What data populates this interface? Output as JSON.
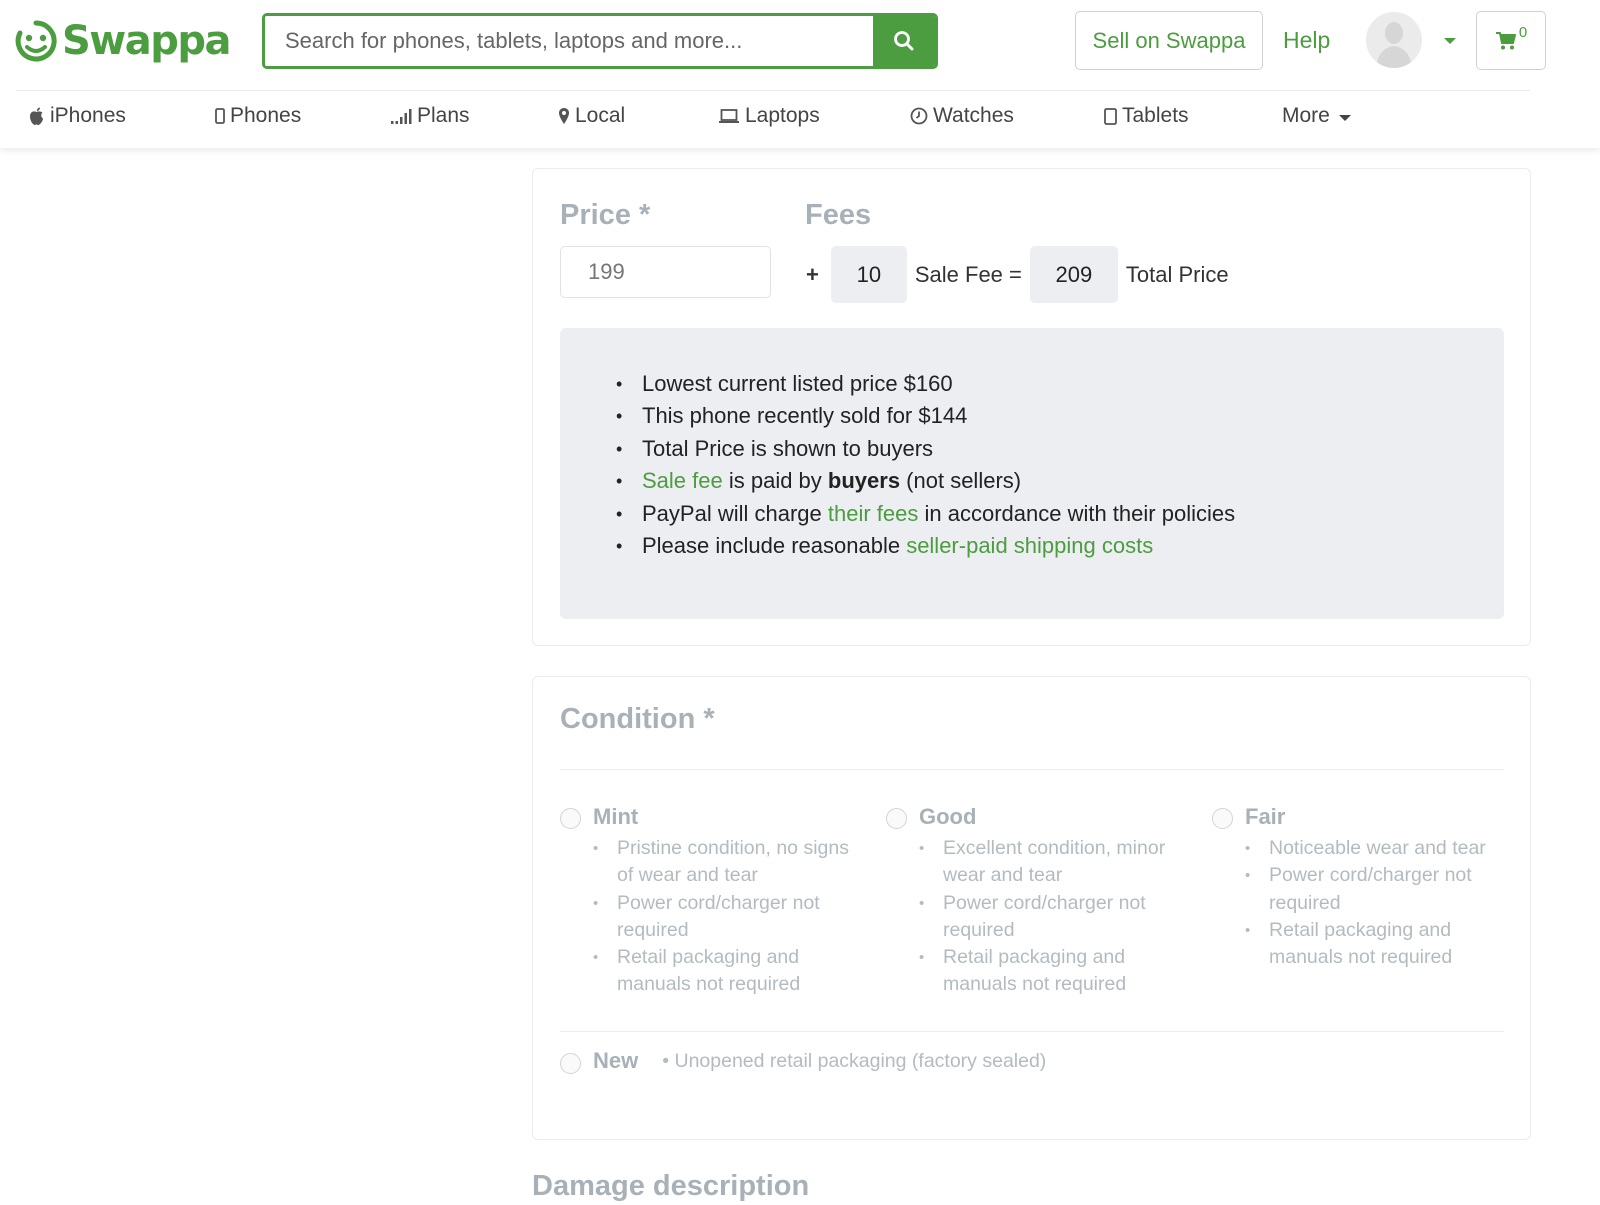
{
  "header": {
    "brand": "Swappa",
    "search": {
      "placeholder": "Search for phones, tablets, laptops and more...",
      "value": "",
      "icon": "search-icon"
    },
    "sell_button": "Sell on Swappa",
    "help_link": "Help",
    "cart": {
      "icon": "cart-icon",
      "count": "0"
    }
  },
  "nav": {
    "items": [
      {
        "label": "iPhones",
        "icon": "apple-icon"
      },
      {
        "label": "Phones",
        "icon": "phone-icon"
      },
      {
        "label": "Plans",
        "icon": "signal-icon"
      },
      {
        "label": "Local",
        "icon": "map-marker-icon"
      },
      {
        "label": "Laptops",
        "icon": "laptop-icon"
      },
      {
        "label": "Watches",
        "icon": "clock-icon"
      },
      {
        "label": "Tablets",
        "icon": "tablet-icon"
      },
      {
        "label": "More",
        "icon": "caret-down-icon"
      }
    ]
  },
  "price": {
    "label": "Price *",
    "input_placeholder": "199",
    "fees_label": "Fees",
    "plus": "+",
    "sale_fee": "10",
    "sale_fee_text": "Sale Fee =",
    "total": "209",
    "total_text": "Total Price",
    "info": {
      "line1": "Lowest current listed price $160",
      "line2": "This phone recently sold for $144",
      "line3": "Total Price is shown to buyers",
      "line4_link": "Sale fee",
      "line4_mid": " is paid by ",
      "line4_bold": "buyers",
      "line4_end": " (not sellers)",
      "line5_start": "PayPal will charge ",
      "line5_link": "their fees",
      "line5_end": " in accordance with their policies",
      "line6_start": "Please include reasonable ",
      "line6_link": "seller-paid shipping costs"
    }
  },
  "condition": {
    "title": "Condition *",
    "options": [
      {
        "name": "Mint",
        "bullets": [
          "Pristine condition, no signs of wear and tear",
          "Power cord/charger not required",
          "Retail packaging and manuals not required"
        ]
      },
      {
        "name": "Good",
        "bullets": [
          "Excellent condition, minor wear and tear",
          "Power cord/charger not required",
          "Retail packaging and manuals not required"
        ]
      },
      {
        "name": "Fair",
        "bullets": [
          "Noticeable wear and tear",
          "Power cord/charger not required",
          "Retail packaging and manuals not required"
        ]
      }
    ],
    "new_option": {
      "name": "New",
      "desc": "• Unopened retail packaging (factory sealed)"
    }
  },
  "damage": {
    "title": "Damage description"
  },
  "colors": {
    "brand_green": "#4c9c40",
    "muted_label": "#a8b1b8",
    "info_bg": "#eceef1"
  }
}
